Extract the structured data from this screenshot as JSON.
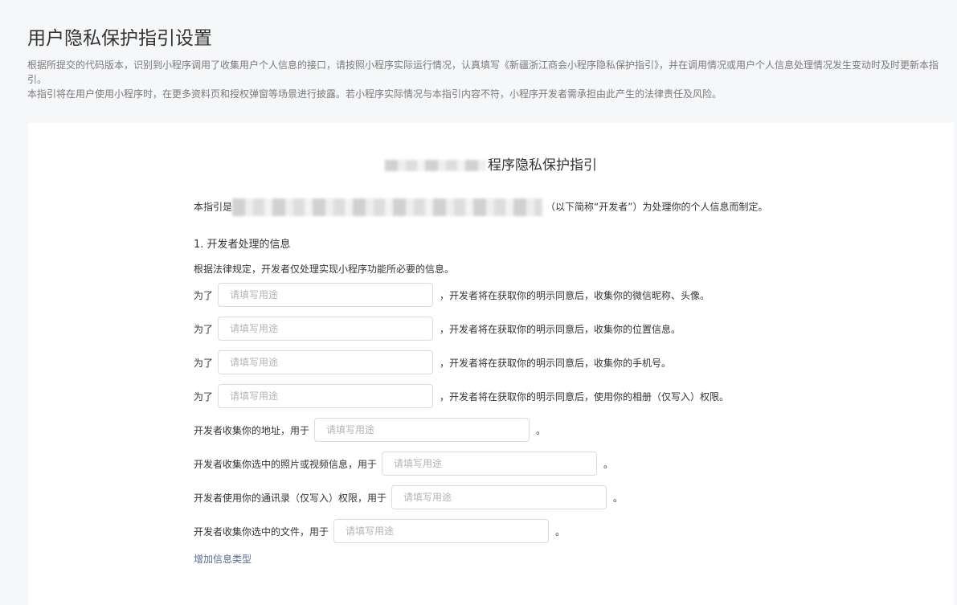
{
  "page": {
    "title": "用户隐私保护指引设置",
    "desc_line1": "根据所提交的代码版本，识别到小程序调用了收集用户个人信息的接口，请按照小程序实际运行情况，认真填写《新疆浙江商会小程序隐私保护指引》，并在调用情况或用户个人信息处理情况发生变动时及时更新本指引。",
    "desc_line2": "本指引将在用户使用小程序时，在更多资料页和授权弹窗等场景进行披露。若小程序实际情况与本指引内容不符，小程序开发者需承担由此产生的法律责任及风险。"
  },
  "guide": {
    "title_suffix": "程序隐私保护指引",
    "intro_prefix": "本指引是",
    "intro_suffix": "（以下简称“开发者”）为处理你的个人信息而制定。",
    "section1_title": "1. 开发者处理的信息",
    "section1_sub": "根据法律规定，开发者仅处理实现小程序功能所必要的信息。",
    "placeholder": "请填写用途",
    "rows": [
      {
        "prefix": "为了",
        "suffix": "，开发者将在获取你的明示同意后，收集你的微信昵称、头像。",
        "value": ""
      },
      {
        "prefix": "为了",
        "suffix": "，开发者将在获取你的明示同意后，收集你的位置信息。",
        "value": ""
      },
      {
        "prefix": "为了",
        "suffix": "，开发者将在获取你的明示同意后，收集你的手机号。",
        "value": ""
      },
      {
        "prefix": "为了",
        "suffix": "，开发者将在获取你的明示同意后，使用你的相册（仅写入）权限。",
        "value": ""
      },
      {
        "prefix": "开发者收集你的地址，用于",
        "suffix": "。",
        "value": ""
      },
      {
        "prefix": "开发者收集你选中的照片或视频信息，用于",
        "suffix": "。",
        "value": ""
      },
      {
        "prefix": "开发者使用你的通讯录（仅写入）权限，用于",
        "suffix": "。",
        "value": ""
      },
      {
        "prefix": "开发者收集你选中的文件，用于",
        "suffix": "。",
        "value": ""
      }
    ],
    "add_link": "增加信息类型"
  },
  "colors": {
    "background": "#f6f7f9",
    "card": "#ffffff",
    "link": "#576b95",
    "placeholder": "#b4b4b4"
  }
}
